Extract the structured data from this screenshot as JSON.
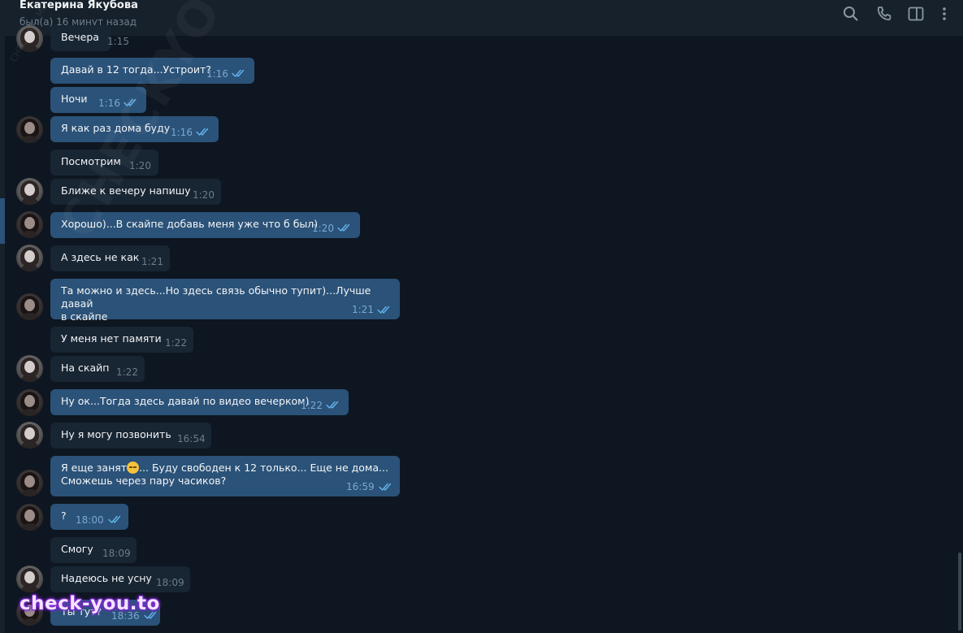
{
  "header": {
    "name": "Екатерина Якубова",
    "status": "был(а) 16 минут назад"
  },
  "watermarks": {
    "diagonal": "CHECKYOU.ME",
    "small": "CHECKYOU.ME",
    "bottom": "check-you.to"
  },
  "colors": {
    "bg": "#0e1621",
    "header": "#17212b",
    "bubble_in": "#182533",
    "bubble_out": "#2b5278",
    "ticks": "#64b5ef"
  },
  "messages": [
    {
      "text": "Вечера",
      "time": "1:15",
      "out": false
    },
    {
      "text": "Давай в 12 тогда...Устроит?",
      "time": "1:16",
      "out": true
    },
    {
      "text": "Ночи",
      "time": "1:16",
      "out": true
    },
    {
      "text": "Я как раз дома буду",
      "time": "1:16",
      "out": true
    },
    {
      "text": "Посмотрим",
      "time": "1:20",
      "out": false
    },
    {
      "text": "Ближе к вечеру напишу",
      "time": "1:20",
      "out": false
    },
    {
      "text": "Хорошо)...В скайпе добавь меня уже что б был)",
      "time": "1:20",
      "out": true
    },
    {
      "text": "А здесь не как",
      "time": "1:21",
      "out": false
    },
    {
      "text": "Та можно и здесь...Но здесь связь обычно тупит)...Лучше давай\nв скайпе",
      "time": "1:21",
      "out": true
    },
    {
      "text": "У меня нет памяти",
      "time": "1:22",
      "out": false
    },
    {
      "text": "На скайп",
      "time": "1:22",
      "out": false
    },
    {
      "text": "Ну ок...Тогда здесь давай по видео вечерком)",
      "time": "1:22",
      "out": true
    },
    {
      "text": "Ну я могу позвонить",
      "time": "16:54",
      "out": false
    },
    {
      "text_before": "Я еще занят",
      "emoji": "pensive-face",
      "text": "... Буду свободен к 12 только... Еще не дома...\nСможешь через пару часиков?",
      "time": "16:59",
      "out": true
    },
    {
      "text": "?",
      "time": "18:00",
      "out": true
    },
    {
      "text": "Смогу",
      "time": "18:09",
      "out": false
    },
    {
      "text": "Надеюсь не усну",
      "time": "18:09",
      "out": false
    },
    {
      "text": "Ты тут?",
      "time": "18:36",
      "out": true
    }
  ]
}
